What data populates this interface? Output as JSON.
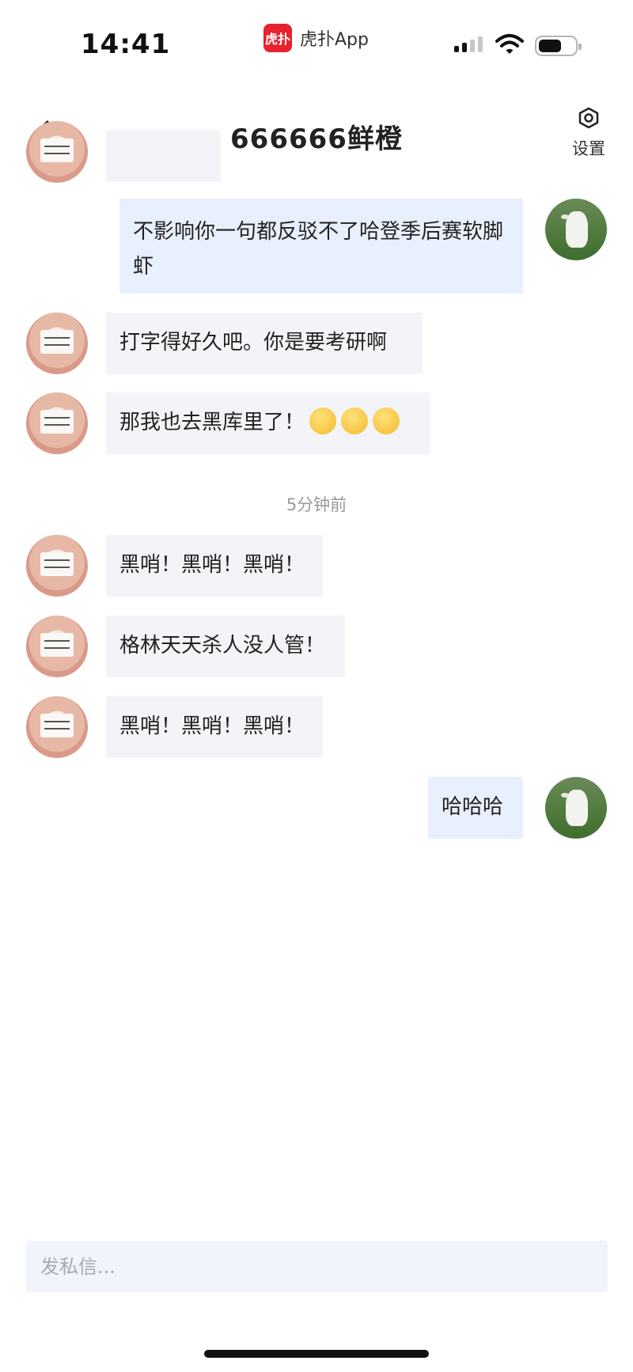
{
  "status_bar": {
    "time": "14:41",
    "app_name": "虎扑App",
    "app_logo_text": "虎扑",
    "battery_level": 0.55
  },
  "header": {
    "title": "666666鲜橙",
    "settings_label": "设置"
  },
  "messages": [
    {
      "side": "right",
      "text": "不影响你一句都反驳不了哈登季后赛软脚虾"
    },
    {
      "side": "left",
      "text": "打字得好久吧。你是要考研啊"
    },
    {
      "side": "left",
      "text": "那我也去黑库里了！",
      "emoji": [
        "🤥",
        "🤥",
        "🤥"
      ]
    },
    {
      "type": "timestamp",
      "text": "5分钟前"
    },
    {
      "side": "left",
      "text": "黑哨！黑哨！黑哨！"
    },
    {
      "side": "left",
      "text": "格林天天杀人没人管！"
    },
    {
      "side": "left",
      "text": "黑哨！黑哨！黑哨！"
    },
    {
      "side": "right",
      "text": "哈哈哈"
    }
  ],
  "composer": {
    "placeholder": "发私信..."
  },
  "colors": {
    "bubble_left": "#f3f4f7",
    "bubble_right": "#e8effd",
    "app_brand": "#e6222e"
  }
}
